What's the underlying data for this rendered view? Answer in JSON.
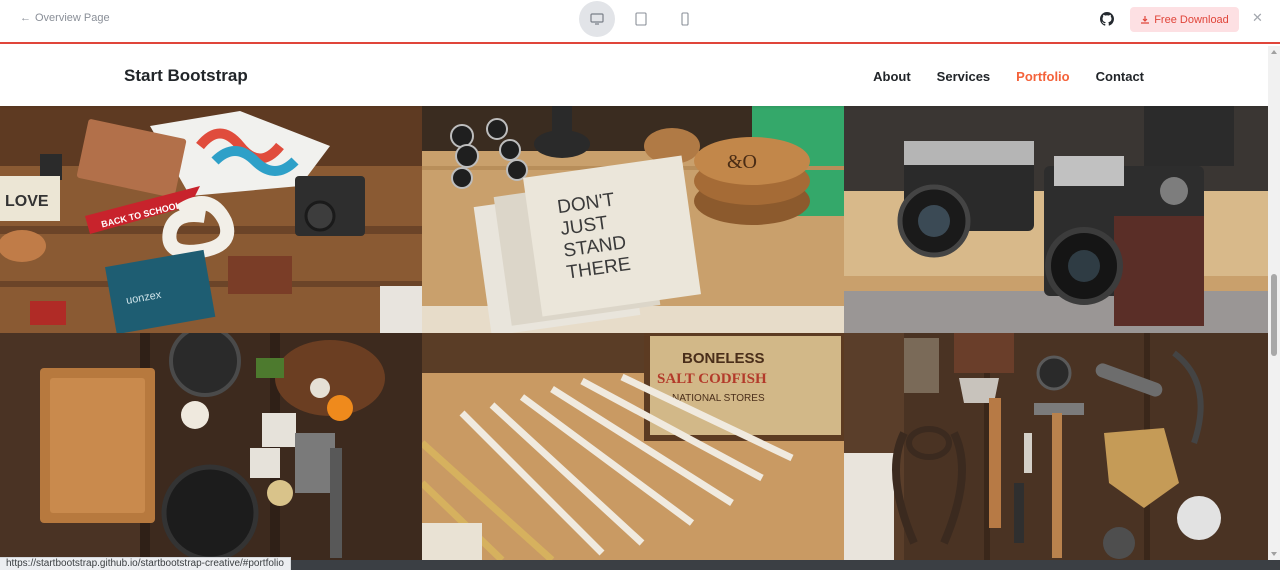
{
  "topbar": {
    "back_label": "Overview Page",
    "devices": [
      "desktop-icon",
      "tablet-icon",
      "mobile-icon"
    ],
    "active_device": "desktop",
    "download_label": "Free Download",
    "accent": "#e0453a"
  },
  "site": {
    "brand": "Start Bootstrap",
    "nav": [
      {
        "label": "About"
      },
      {
        "label": "Services"
      },
      {
        "label": "Portfolio"
      },
      {
        "label": "Contact"
      }
    ],
    "active_nav": "Portfolio",
    "active_color": "#f4623a"
  },
  "portfolio": {
    "items": [
      {
        "name": "flatlay-desk-items",
        "text": "BACK TO SCHOOL"
      },
      {
        "name": "notebooks-dont-just-stand-there",
        "text": "DON'T JUST STAND THERE"
      },
      {
        "name": "vintage-cameras"
      },
      {
        "name": "kitchen-cutting-board"
      },
      {
        "name": "folding-rulers",
        "text": "SALT CODFISH"
      },
      {
        "name": "vintage-tools"
      }
    ]
  },
  "status_url": "https://startbootstrap.github.io/startbootstrap-creative/#portfolio"
}
